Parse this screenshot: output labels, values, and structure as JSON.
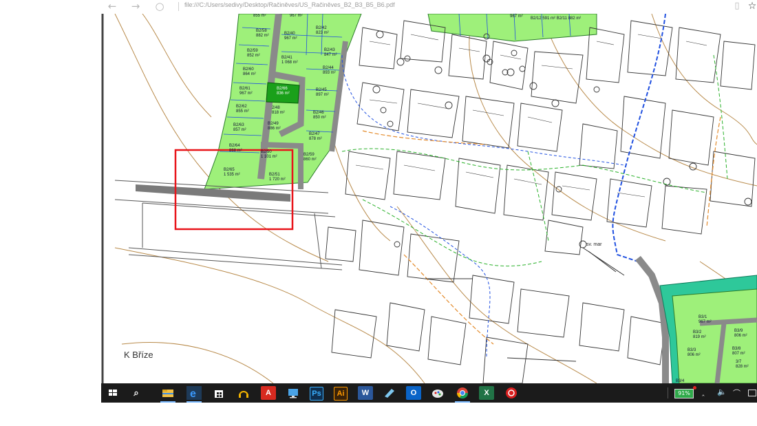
{
  "browser": {
    "back_glyph": "←",
    "forward_glyph": "→",
    "refresh_glyph": "○",
    "url": "file:///C:/Users/sedivy/Desktop/Račiněves/US_Račiněves_B2_B3_B5_B6.pdf",
    "reading_view_glyph": "▯",
    "favorite_glyph": "☆"
  },
  "map": {
    "street_label": "K Bříze",
    "church_label": "sv. mar",
    "top_fragment": "B2/12 591 m² B2/11 882 m²",
    "top_area": "967 m²",
    "lots_b2": [
      {
        "id": "B2/58",
        "area": "882 m²"
      },
      {
        "id": "B2/40",
        "area": "967 m²"
      },
      {
        "id": "B2/42",
        "area": "823 m²"
      },
      {
        "id": "B2/59",
        "area": "852 m²"
      },
      {
        "id": "B2/41",
        "area": "1 068 m²"
      },
      {
        "id": "B2/43",
        "area": "847 m²"
      },
      {
        "id": "B2/60",
        "area": "864 m²"
      },
      {
        "id": "B2/44",
        "area": "893 m²"
      },
      {
        "id": "B2/61",
        "area": "967 m²"
      },
      {
        "id": "B2/66",
        "area": "836 m²"
      },
      {
        "id": "B2/45",
        "area": "897 m²"
      },
      {
        "id": "B2/62",
        "area": "855 m²"
      },
      {
        "id": "2/48",
        "area": "818 m²"
      },
      {
        "id": "B2/46",
        "area": "850 m²"
      },
      {
        "id": "B2/63",
        "area": "857 m²"
      },
      {
        "id": "B2/49",
        "area": "886 m²"
      },
      {
        "id": "B2/47",
        "area": "878 m²"
      },
      {
        "id": "B2/64",
        "area": "868 m²"
      },
      {
        "id": "B2/50",
        "area": "1 101 m²"
      },
      {
        "id": "B2/59",
        "area": "860 m²"
      },
      {
        "id": "B2/65",
        "area": "1 535 m²"
      },
      {
        "id": "B2/51",
        "area": "1 720 m²"
      }
    ],
    "lots_b3": [
      {
        "id": "B3/1",
        "area": "967 m²"
      },
      {
        "id": "B3/9",
        "area": "806 m²"
      },
      {
        "id": "B3/2",
        "area": "819 m²"
      },
      {
        "id": "B3/3",
        "area": "806 m²"
      },
      {
        "id": "B3/8",
        "area": "807 m²"
      },
      {
        "id": "3/7",
        "area": "828 m²"
      },
      {
        "id": "B3/4",
        "area": ""
      }
    ]
  },
  "taskbar": {
    "search_glyph": "⌕",
    "battery": "91%",
    "apps": [
      "file-explorer",
      "edge",
      "store",
      "headphones",
      "adobe-acrobat",
      "computer",
      "photoshop",
      "illustrator",
      "word",
      "notes",
      "outlook",
      "paint",
      "chrome",
      "excel",
      "antivirus"
    ],
    "adobe_text": "A",
    "ps_text": "Ps",
    "ai_text": "Ai",
    "word_text": "W",
    "excel_text": "X",
    "outlook_text": "O"
  },
  "colors": {
    "lot_green": "#9ef07a",
    "dark_green": "#1aa01a",
    "road_grey": "#8a8a8a",
    "highlight_red": "#e8141a",
    "contour_brown": "#b88a4a",
    "boundary_blue": "#2050e0",
    "teal": "#2ec89a"
  }
}
